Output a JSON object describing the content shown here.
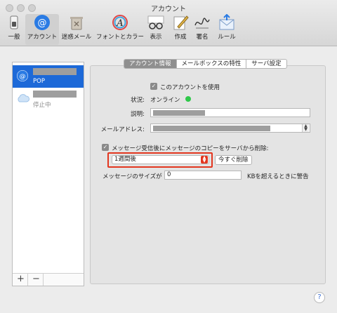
{
  "window": {
    "title": "アカウント"
  },
  "toolbar": {
    "items": [
      {
        "label": "一般",
        "icon": "switch-icon"
      },
      {
        "label": "アカウント",
        "icon": "at-sign-icon"
      },
      {
        "label": "迷惑メール",
        "icon": "trash-icon"
      },
      {
        "label": "フォントとカラー",
        "icon": "font-icon"
      },
      {
        "label": "表示",
        "icon": "glasses-icon"
      },
      {
        "label": "作成",
        "icon": "compose-icon"
      },
      {
        "label": "署名",
        "icon": "signature-icon"
      },
      {
        "label": "ルール",
        "icon": "rules-icon"
      }
    ],
    "active": "アカウント"
  },
  "sidebar": {
    "accounts": [
      {
        "subtitle": "POP",
        "selected": true,
        "icon": "at-sign-icon"
      },
      {
        "subtitle": "停止中",
        "selected": false,
        "icon": "cloud-icon"
      }
    ],
    "add_label": "+",
    "remove_label": "−"
  },
  "tabs": [
    "アカウント情報",
    "メールボックスの特性",
    "サーバ設定"
  ],
  "form": {
    "enable_account_label": "このアカウントを使用",
    "status_label": "状況:",
    "status_value": "オンライン",
    "description_label": "説明:",
    "email_label": "メールアドレス:",
    "remove_copy_label": "メッセージ受信後にメッセージのコピーをサーバから削除:",
    "remove_period_value": "1週間後",
    "remove_now_label": "今すぐ削除",
    "size_prefix": "メッセージのサイズが",
    "size_value": "0",
    "size_suffix": "KBを超えるときに警告"
  },
  "help_label": "?",
  "colors": {
    "accent": "#1d69d8",
    "online": "#2fc84a",
    "highlight": "#e3361f"
  }
}
